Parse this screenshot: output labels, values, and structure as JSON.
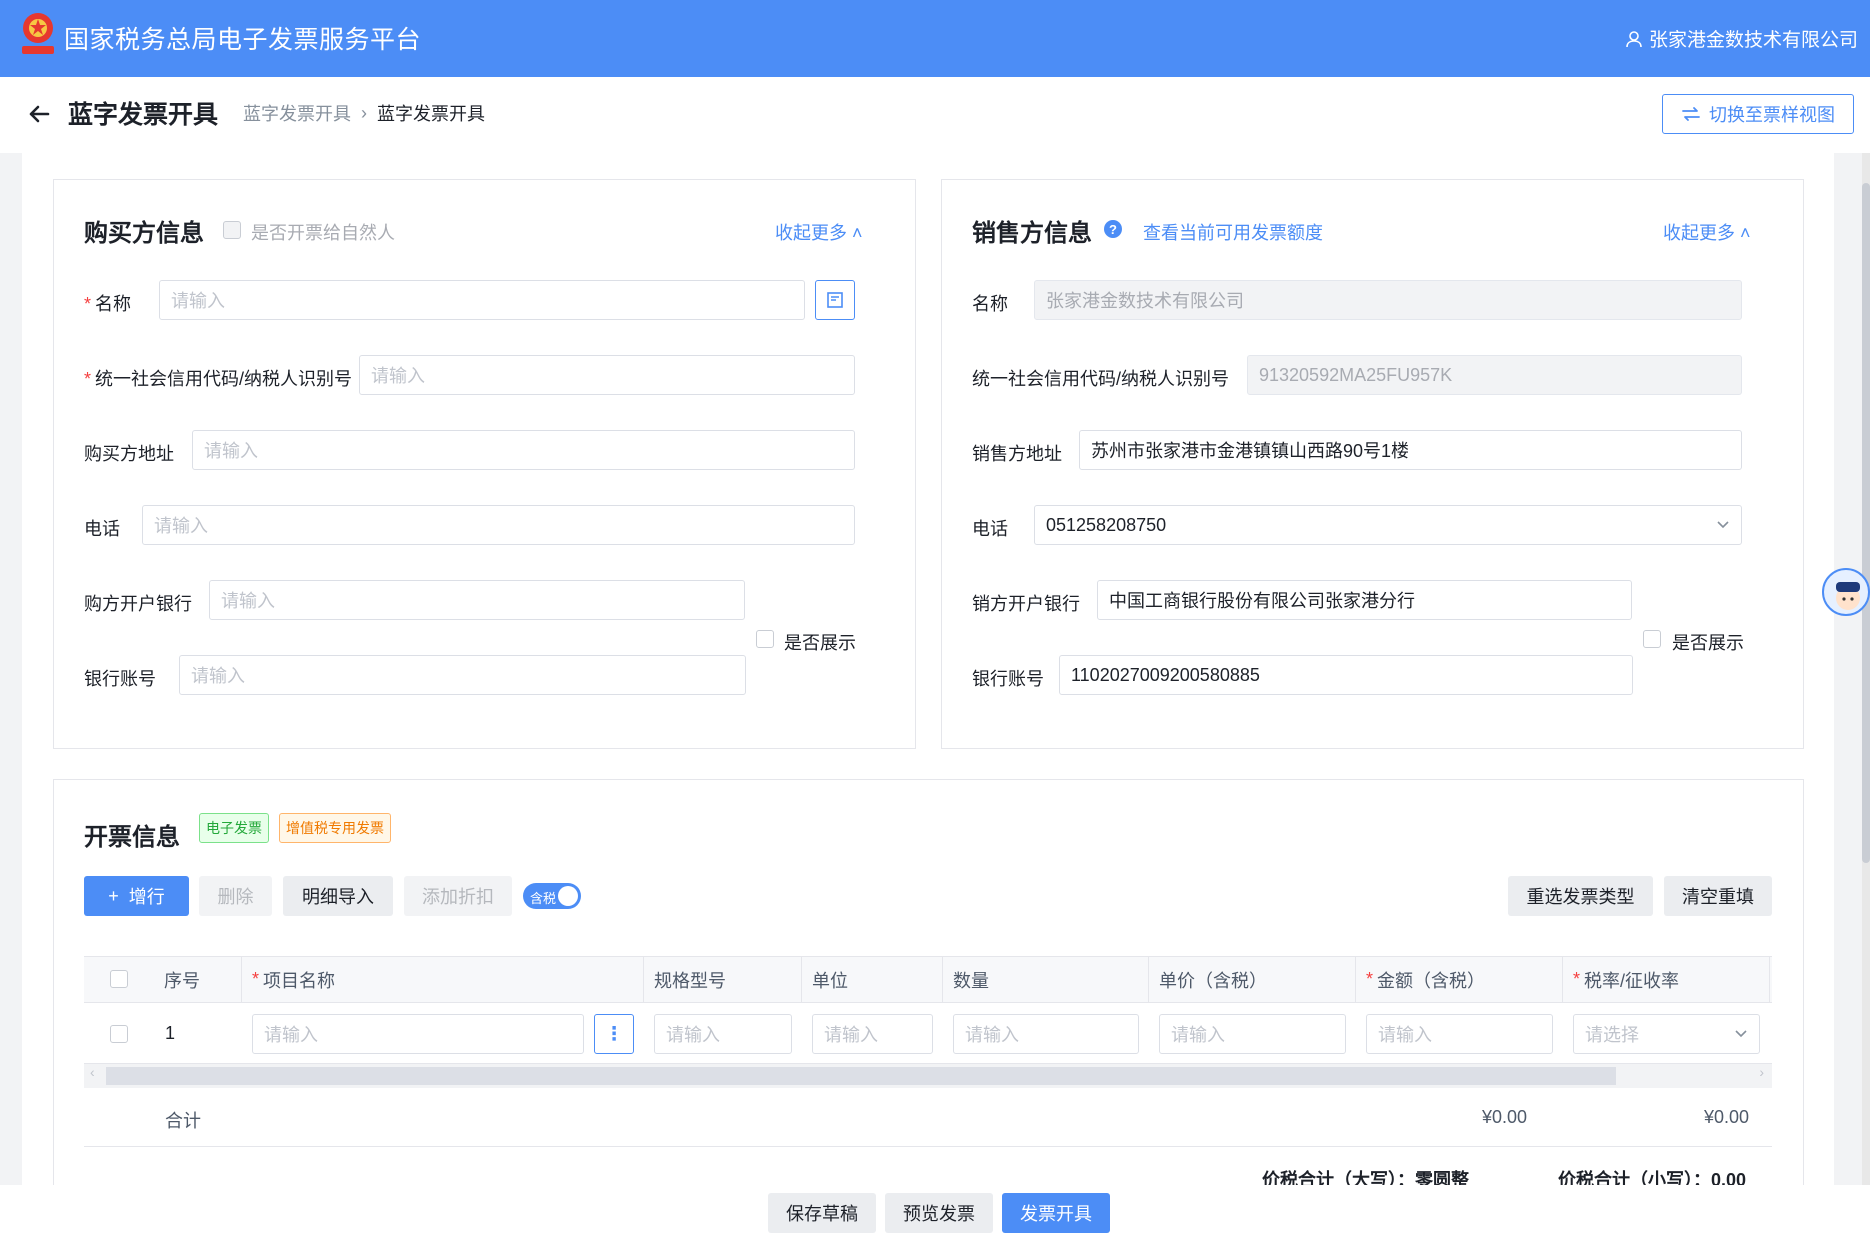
{
  "header": {
    "app_title": "国家税务总局电子发票服务平台",
    "user_name": "张家港金数技术有限公司"
  },
  "subheader": {
    "page_title": "蓝字发票开具",
    "breadcrumb": [
      "蓝字发票开具",
      "蓝字发票开具"
    ],
    "switch_view": "切换至票样视图"
  },
  "buyer": {
    "title": "购买方信息",
    "natural_person": "是否开票给自然人",
    "collapse": "收起更多",
    "fields": {
      "name": {
        "label": "名称",
        "placeholder": "请输入",
        "required": true
      },
      "tax_id": {
        "label": "统一社会信用代码/纳税人识别号",
        "placeholder": "请输入",
        "required": true
      },
      "address": {
        "label": "购买方地址",
        "placeholder": "请输入"
      },
      "phone": {
        "label": "电话",
        "placeholder": "请输入"
      },
      "bank": {
        "label": "购方开户银行",
        "placeholder": "请输入"
      },
      "account": {
        "label": "银行账号",
        "placeholder": "请输入"
      }
    },
    "show_label": "是否展示"
  },
  "seller": {
    "title": "销售方信息",
    "quota_link": "查看当前可用发票额度",
    "collapse": "收起更多",
    "fields": {
      "name": {
        "label": "名称",
        "value": "张家港金数技术有限公司"
      },
      "tax_id": {
        "label": "统一社会信用代码/纳税人识别号",
        "value": "91320592MA25FU957K"
      },
      "address": {
        "label": "销售方地址",
        "value": "苏州市张家港市金港镇镇山西路90号1楼"
      },
      "phone": {
        "label": "电话",
        "value": "051258208750"
      },
      "bank": {
        "label": "销方开户银行",
        "value": "中国工商银行股份有限公司张家港分行"
      },
      "account": {
        "label": "银行账号",
        "value": "1102027009200580885"
      }
    },
    "show_label": "是否展示"
  },
  "invoice": {
    "title": "开票信息",
    "tag_electronic": "电子发票",
    "tag_vat": "增值税专用发票",
    "toolbar": {
      "add_row": "增行",
      "delete": "删除",
      "import": "明细导入",
      "discount": "添加折扣",
      "tax_toggle": "含税",
      "reselect": "重选发票类型",
      "clear": "清空重填"
    },
    "columns": [
      "序号",
      "项目名称",
      "规格型号",
      "单位",
      "数量",
      "单价（含税）",
      "金额（含税）",
      "税率/征收率"
    ],
    "row": {
      "index": "1",
      "placeholder": "请输入",
      "select_placeholder": "请选择"
    },
    "total_label": "合计",
    "total_amount": "¥0.00",
    "total_tax": "¥0.00",
    "summary_upper_label": "价税合计（大写）：",
    "summary_upper_value": "零圆整",
    "summary_lower_label": "价税合计（小写）：",
    "summary_lower_value": "0.00"
  },
  "footer": {
    "save_draft": "保存草稿",
    "preview": "预览发票",
    "issue": "发票开具"
  },
  "colors": {
    "brand": "#4c8df6",
    "required": "#f53f3f"
  }
}
